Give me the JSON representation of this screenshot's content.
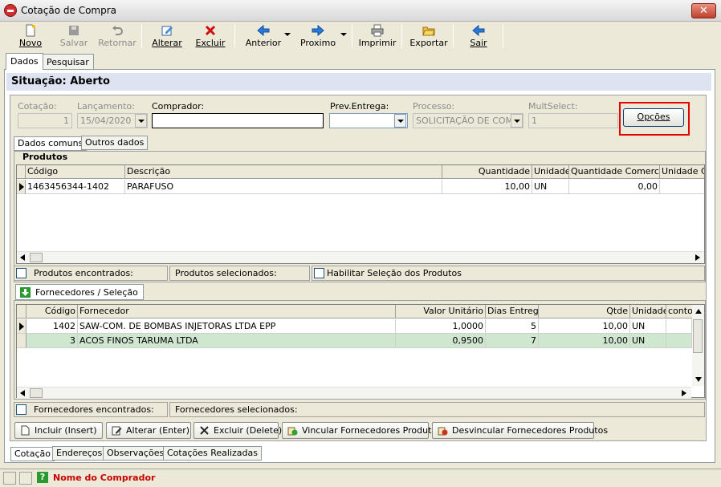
{
  "window": {
    "title": "Cotação de Compra",
    "close": "✕"
  },
  "toolbar": {
    "novo": "Novo",
    "salvar": "Salvar",
    "retornar": "Retornar",
    "alterar": "Alterar",
    "excluir": "Excluir",
    "anterior": "Anterior",
    "proximo": "Proximo",
    "imprimir": "Imprimir",
    "exportar": "Exportar",
    "sair": "Sair"
  },
  "tabs": {
    "dados": "Dados",
    "pesquisar": "Pesquisar"
  },
  "situacao": "Situação: Aberto",
  "form": {
    "cotacao_label": "Cotação:",
    "cotacao_value": "1",
    "lancamento_label": "Lançamento:",
    "lancamento_value": "15/04/2020",
    "comprador_label": "Comprador:",
    "comprador_value": "",
    "prev_entrega_label": "Prev.Entrega:",
    "prev_entrega_value": "",
    "processo_label": "Processo:",
    "processo_value": "SOLICITAÇÃO DE COM",
    "multselect_label": "MultSelect:",
    "multselect_value": "1",
    "opcoes_button": "Opções"
  },
  "subtabs": {
    "dados_comuns": "Dados comuns",
    "outros_dados": "Outros dados"
  },
  "produtos": {
    "title": "Produtos",
    "columns": [
      "Código",
      "Descrição",
      "Quantidade",
      "Unidade",
      "Quantidade Comercial",
      "Unidade Co"
    ],
    "rows": [
      {
        "codigo": "1463456344-1402",
        "descricao": "PARAFUSO",
        "quantidade": "10,00",
        "unidade": "UN",
        "qtd_comercial": "0,00",
        "unidade_co": ""
      }
    ],
    "encontrados_label": "Produtos encontrados:",
    "selecionados_label": "Produtos selecionados:",
    "habilitar_label": "Habilitar Seleção dos Produtos"
  },
  "fornecedores": {
    "tab": "Fornecedores / Seleção",
    "columns": [
      "Código",
      "Fornecedor",
      "Valor Unitário",
      "Dias Entrega",
      "Qtde",
      "Unidade",
      "conto"
    ],
    "rows": [
      {
        "codigo": "1402",
        "fornecedor": "SAW-COM. DE BOMBAS INJETORAS LTDA EPP",
        "valor": "1,0000",
        "dias": "5",
        "qtde": "10,00",
        "unidade": "UN"
      },
      {
        "codigo": "3",
        "fornecedor": "ACOS FINOS TARUMA LTDA",
        "valor": "0,9500",
        "dias": "7",
        "qtde": "10,00",
        "unidade": "UN"
      }
    ],
    "encontrados_label": "Fornecedores encontrados:",
    "selecionados_label": "Fornecedores selecionados:"
  },
  "actions": {
    "incluir": "Incluir (Insert)",
    "alterar": "Alterar (Enter)",
    "excluir": "Excluir (Delete)",
    "vincular": "Vincular Fornecedores Produtos",
    "desvincular": "Desvincular Fornecedores Produtos"
  },
  "bottom_tabs": {
    "cotacao": "Cotação",
    "enderecos": "Endereços",
    "observacoes": "Observações",
    "cotacoes_realizadas": "Cotações Realizadas"
  },
  "statusbar": {
    "hint_icon": "?",
    "text": "Nome do Comprador"
  },
  "colors": {
    "highlight_row": "#cfe6cf",
    "red_box": "#e60000",
    "status_text": "#cc0000"
  }
}
